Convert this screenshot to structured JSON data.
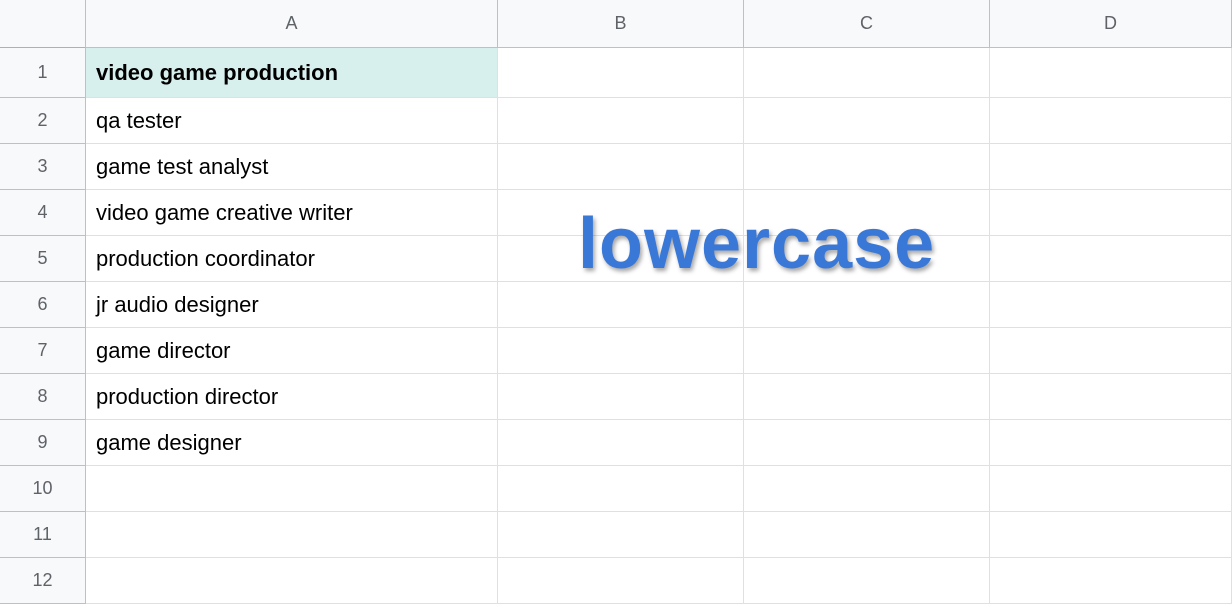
{
  "columns": [
    "A",
    "B",
    "C",
    "D"
  ],
  "rows": [
    "1",
    "2",
    "3",
    "4",
    "5",
    "6",
    "7",
    "8",
    "9",
    "10",
    "11",
    "12"
  ],
  "cells": {
    "a1": "video game production",
    "a2": "qa tester",
    "a3": "game test analyst",
    "a4": "video game creative writer",
    "a5": "production coordinator",
    "a6": "jr audio designer",
    "a7": "game director",
    "a8": "production director",
    "a9": "game designer"
  },
  "overlay": "lowercase"
}
